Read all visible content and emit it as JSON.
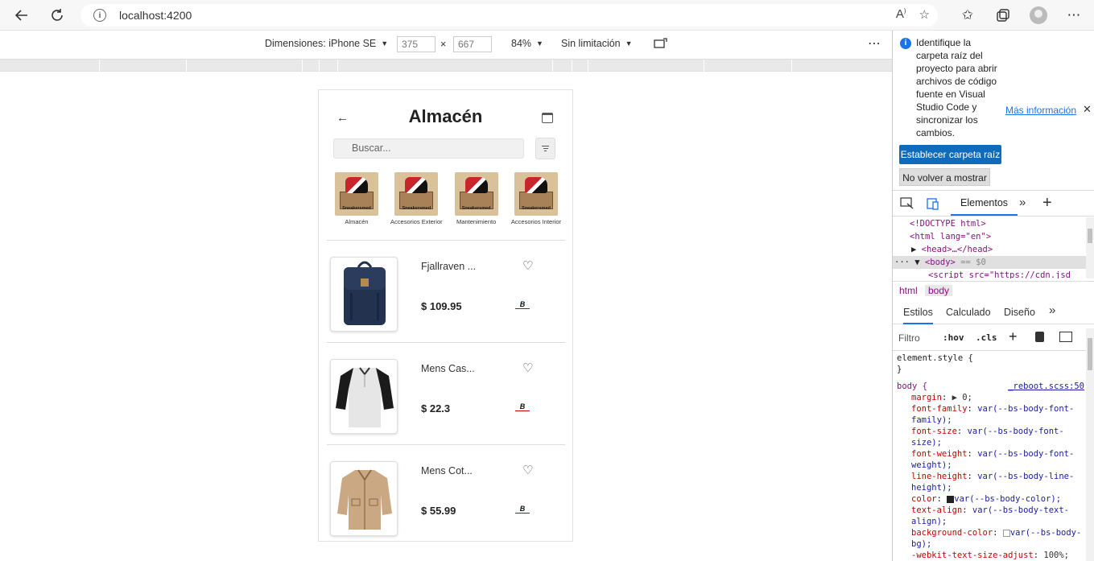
{
  "browser": {
    "url": "localhost:4200"
  },
  "device_toolbar": {
    "dimensions_label": "Dimensiones: iPhone SE",
    "width": "375",
    "x_sep": "×",
    "height": "667",
    "zoom": "84%",
    "throttle": "Sin limitación"
  },
  "app": {
    "title": "Almacén",
    "search_placeholder": "Buscar...",
    "categories": [
      {
        "label": "Almacén",
        "brand": "Sneakersmed"
      },
      {
        "label": "Accesorios Exterior",
        "brand": "Sneakersmed"
      },
      {
        "label": "Mantenimiento",
        "brand": "Sneakersmed"
      },
      {
        "label": "Accesorios Interior",
        "brand": "Sneakersmed"
      }
    ],
    "products": [
      {
        "name": "Fjallraven ...",
        "price": "$ 109.95"
      },
      {
        "name": "Mens Cas...",
        "price": "$ 22.3"
      },
      {
        "name": "Mens Cot...",
        "price": "$ 55.99"
      }
    ]
  },
  "devtools": {
    "info_text": "Identifique la carpeta raíz del proyecto para abrir archivos de código fuente en Visual Studio Code y sincronizar los cambios.",
    "more_info": "Más información",
    "set_root_button": "Establecer carpeta raíz",
    "dont_show_button": "No volver a mostrar",
    "main_tab": "Elementos",
    "dom_lines": {
      "doctype": "<!DOCTYPE html>",
      "html_open": "<html lang=\"en\">",
      "head": "<head>…</head>",
      "body": "<body>",
      "body_eq": "== $0",
      "script": "<script src=\"https://cdn.jsd"
    },
    "crumbs": [
      "html",
      "body"
    ],
    "sub_tabs": [
      "Estilos",
      "Calculado",
      "Diseño"
    ],
    "filter_placeholder": "Filtro",
    "hov": ":hov",
    "cls": ".cls",
    "element_style": "element.style {",
    "close_brace": "}",
    "body_rule": "body {",
    "source": "_reboot.scss:50",
    "styles": [
      {
        "prop": "margin",
        "val": "▶ 0;"
      },
      {
        "prop": "font-family",
        "val": "var(--bs-body-font-family);"
      },
      {
        "prop": "font-size",
        "val": "var(--bs-body-font-size);"
      },
      {
        "prop": "font-weight",
        "val": "var(--bs-body-font-weight);"
      },
      {
        "prop": "line-height",
        "val": "var(--bs-body-line-height);"
      },
      {
        "prop": "color",
        "val": "var(--bs-body-color);"
      },
      {
        "prop": "text-align",
        "val": "var(--bs-body-text-align);"
      },
      {
        "prop": "background-color",
        "val": "var(--bs-body-bg);"
      },
      {
        "prop": "-webkit-text-size-adjust",
        "val": "100%;"
      }
    ]
  }
}
